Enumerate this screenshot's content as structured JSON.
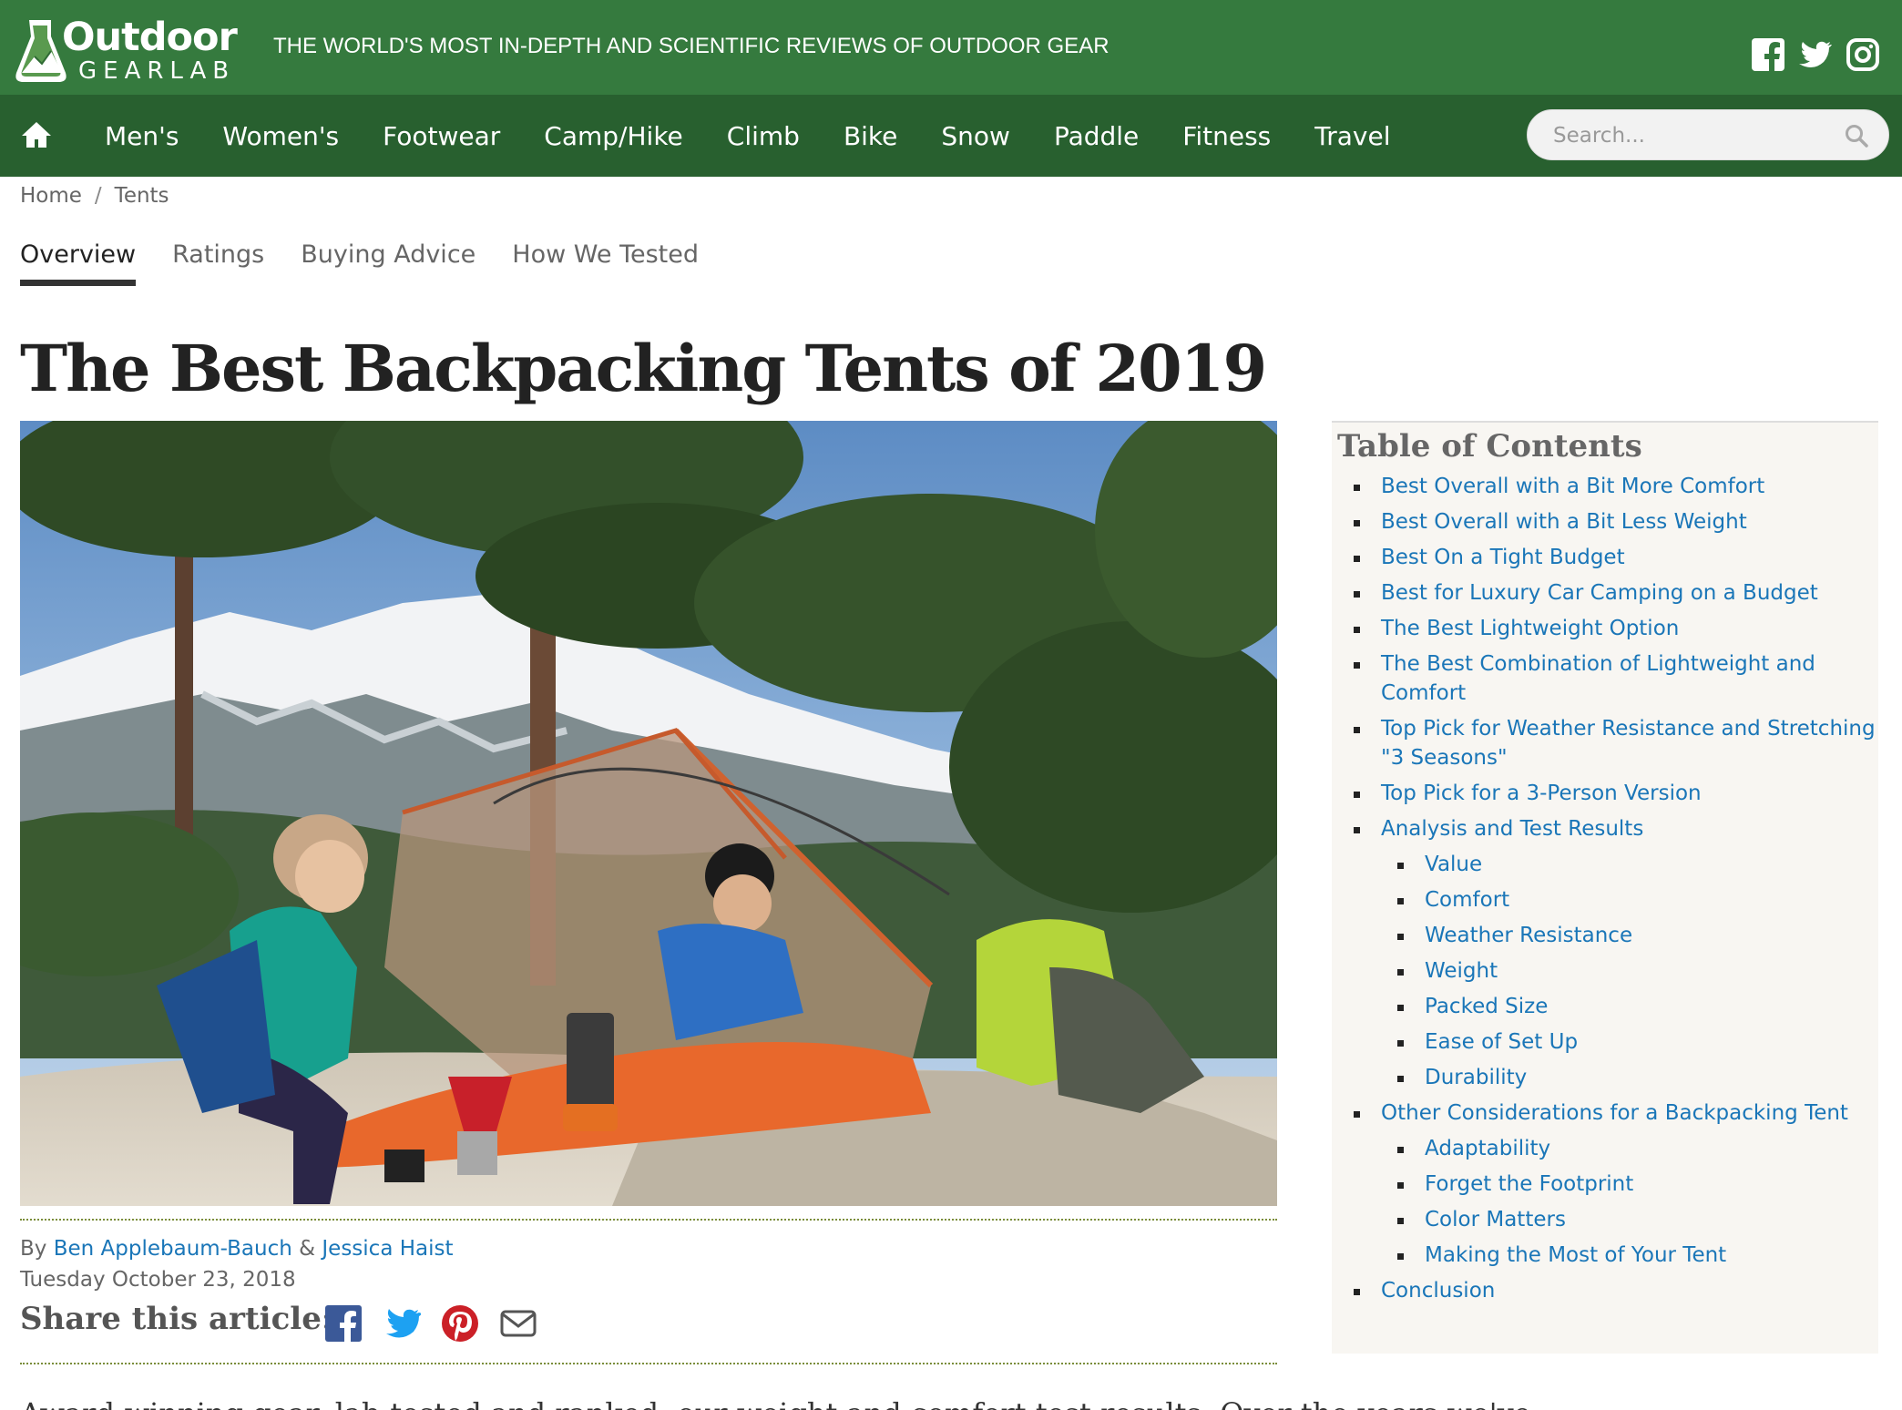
{
  "header": {
    "logo_word1": "Outdoor",
    "logo_word2": "GEARLAB",
    "tagline": "THE WORLD'S MOST IN-DEPTH AND SCIENTIFIC REVIEWS OF OUTDOOR GEAR",
    "bar_color": "#357a3e",
    "social_icons": [
      "facebook-icon",
      "twitter-icon",
      "instagram-icon"
    ]
  },
  "nav": {
    "bar_color": "#28602f",
    "home_icon": "home-icon",
    "links": [
      "Men's",
      "Women's",
      "Footwear",
      "Camp/Hike",
      "Climb",
      "Bike",
      "Snow",
      "Paddle",
      "Fitness",
      "Travel"
    ],
    "search_placeholder": "Search..."
  },
  "breadcrumb": {
    "home": "Home",
    "separator": "/",
    "current": "Tents"
  },
  "tabs": [
    {
      "label": "Overview",
      "active": true
    },
    {
      "label": "Ratings",
      "active": false
    },
    {
      "label": "Buying Advice",
      "active": false
    },
    {
      "label": "How We Tested",
      "active": false
    }
  ],
  "article": {
    "title": "The Best Backpacking Tents of 2019",
    "by": "By",
    "author1": "Ben Applebaum-Bauch",
    "amp": "&",
    "author2": "Jessica Haist",
    "date": "Tuesday October 23, 2018",
    "share_label": "Share this article:",
    "share_icons": [
      "facebook-icon",
      "twitter-icon",
      "pinterest-icon",
      "email-icon"
    ],
    "body_start": "Award-winning gear, lab-tested and ranked, our weight and comfort test results. Over the years we've"
  },
  "toc": {
    "title": "Table of Contents",
    "items": [
      {
        "label": "Best Overall with a Bit More Comfort",
        "level": 1
      },
      {
        "label": "Best Overall with a Bit Less Weight",
        "level": 1
      },
      {
        "label": "Best On a Tight Budget",
        "level": 1
      },
      {
        "label": "Best for Luxury Car Camping on a Budget",
        "level": 1
      },
      {
        "label": "The Best Lightweight Option",
        "level": 1
      },
      {
        "label": "The Best Combination of Lightweight and Comfort",
        "level": 1
      },
      {
        "label": "Top Pick for Weather Resistance and Stretching \"3 Seasons\"",
        "level": 1
      },
      {
        "label": "Top Pick for a 3-Person Version",
        "level": 1
      },
      {
        "label": "Analysis and Test Results",
        "level": 1
      },
      {
        "label": "Value",
        "level": 2
      },
      {
        "label": "Comfort",
        "level": 2
      },
      {
        "label": "Weather Resistance",
        "level": 2
      },
      {
        "label": "Weight",
        "level": 2
      },
      {
        "label": "Packed Size",
        "level": 2
      },
      {
        "label": "Ease of Set Up",
        "level": 2
      },
      {
        "label": "Durability",
        "level": 2
      },
      {
        "label": "Other Considerations for a Backpacking Tent",
        "level": 1
      },
      {
        "label": "Adaptability",
        "level": 2
      },
      {
        "label": "Forget the Footprint",
        "level": 2
      },
      {
        "label": "Color Matters",
        "level": 2
      },
      {
        "label": "Making the Most of Your Tent",
        "level": 2
      },
      {
        "label": "Conclusion",
        "level": 1
      }
    ]
  },
  "colors": {
    "link": "#1a76b8",
    "divider": "#7a8d3a",
    "toc_bg": "#f8f6f2"
  }
}
